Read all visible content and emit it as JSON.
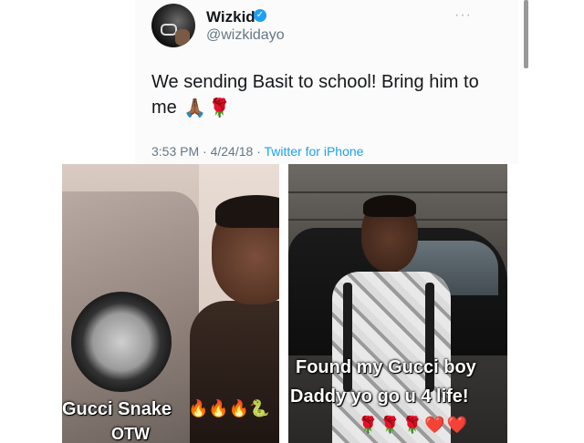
{
  "tweet": {
    "display_name": "Wizkid",
    "handle": "@wizkidayo",
    "verified_icon": "check",
    "more_icon": "···",
    "text": "We sending Basit to school! Bring him to me",
    "text_emojis": [
      "🙏🏾",
      "🌹"
    ],
    "timestamp": "3:53 PM · 4/24/18",
    "separator": "·",
    "source": "Twitter for iPhone"
  },
  "photos": {
    "left": {
      "caption_line1": "Gucci Snake",
      "caption_line1_emojis": "🔥🔥🔥🐍",
      "caption_line2": "OTW"
    },
    "right": {
      "caption_line1": "Found my Gucci boy",
      "caption_line2": "Daddy yo go u 4 life!",
      "hearts": "🌹🌹🌹❤️❤️"
    }
  },
  "colors": {
    "link": "#1da1f2",
    "secondary_text": "#657786",
    "primary_text": "#14171a"
  }
}
